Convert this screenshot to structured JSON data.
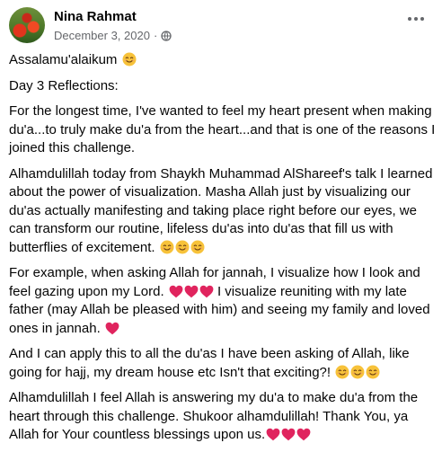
{
  "post": {
    "author": "Nina Rahmat",
    "date": "December 3, 2020",
    "separator": "·",
    "audience_icon": "globe-icon",
    "more_icon": "more-options-icon"
  },
  "content": {
    "p1": "Assalamu'alaikum",
    "p2": "Day 3 Reflections:",
    "p3": "For the longest time, I've wanted to feel my heart present when making du'a...to truly make du'a from the heart...and that is one of the reasons I joined this challenge.",
    "p4": "Alhamdulillah today from Shaykh Muhammad AlShareef's talk I learned about the power of visualization. Masha Allah just by visualizing our du'as actually manifesting and taking place right before our eyes, we can transform our routine, lifeless du'as into du'as that fill us with butterflies of excitement.",
    "p5a": "For example, when asking Allah for jannah, I visualize how I look and feel gazing upon my Lord.",
    "p5b": "I visualize reuniting with my late father (may Allah be pleased with him) and seeing my family and loved ones in jannah.",
    "p6": "And I can apply this to all the du'as I have been asking of Allah, like going for hajj, my dream house etc Isn't that exciting?!",
    "p7": "Alhamdulillah I feel Allah is answering my du'a to make du'a from the heart through this challenge. Shukoor alhamdulillah! Thank You, ya Allah for Your countless blessings upon us."
  },
  "emoji": {
    "smile": "smiling-face-icon",
    "heart": "red-heart-icon",
    "smile_color": "#f7c23a",
    "heart_color": "#e0245e"
  }
}
